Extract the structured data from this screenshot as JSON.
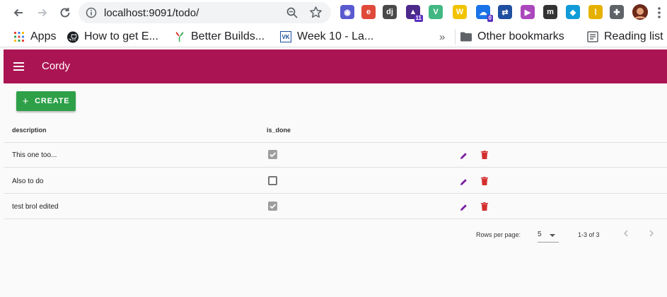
{
  "browser": {
    "url": "localhost:9091/todo/",
    "extensions": [
      {
        "name": "privacy-badger-icon",
        "color": "#5a5ad0",
        "glyph": "◉"
      },
      {
        "name": "e-extension-icon",
        "color": "#e04a3a",
        "glyph": "e"
      },
      {
        "name": "django-icon",
        "color": "#4a4a4a",
        "glyph": "dj"
      },
      {
        "name": "grad-cap-icon",
        "color": "#4b2a8a",
        "glyph": "▲",
        "badge": "11"
      },
      {
        "name": "vue-devtools-icon",
        "color": "#41b883",
        "glyph": "V"
      },
      {
        "name": "w-extension-icon",
        "color": "#f2c400",
        "glyph": "W"
      },
      {
        "name": "cloud-extension-icon",
        "color": "#1a73e8",
        "glyph": "☁",
        "badge": "0"
      },
      {
        "name": "sync-arrows-icon",
        "color": "#1f4fa0",
        "glyph": "⇄"
      },
      {
        "name": "play-extension-icon",
        "color": "#ab47bc",
        "glyph": "▶"
      },
      {
        "name": "m-extension-icon",
        "color": "#333333",
        "glyph": "m"
      },
      {
        "name": "diamond-extension-icon",
        "color": "#0f9bd7",
        "glyph": "◆"
      },
      {
        "name": "broom-extension-icon",
        "color": "#e5b100",
        "glyph": "⌇"
      },
      {
        "name": "puzzle-icon",
        "color": "#5f6368",
        "glyph": "✚"
      }
    ]
  },
  "bookmarks": {
    "items": [
      {
        "label": "Apps",
        "icon": "apps-grid-icon"
      },
      {
        "label": "How to get E...",
        "icon": "github-icon"
      },
      {
        "label": "Better Builds...",
        "icon": "flower-icon"
      },
      {
        "label": "Week 10 - La...",
        "icon": "vk-icon"
      }
    ],
    "overflow": "»",
    "other": "Other bookmarks",
    "reading_list": "Reading list"
  },
  "app": {
    "title": "Cordy",
    "bar_color": "#ab1452",
    "create_label": "CREATE"
  },
  "table": {
    "headers": [
      "description",
      "is_done"
    ],
    "rows": [
      {
        "description": "This one too...",
        "is_done": true
      },
      {
        "description": "Also to do",
        "is_done": false
      },
      {
        "description": "test brol edited",
        "is_done": true
      }
    ]
  },
  "pagination": {
    "rows_per_page_label": "Rows per page:",
    "rows_per_page": "5",
    "range": "1-3 of 3"
  }
}
